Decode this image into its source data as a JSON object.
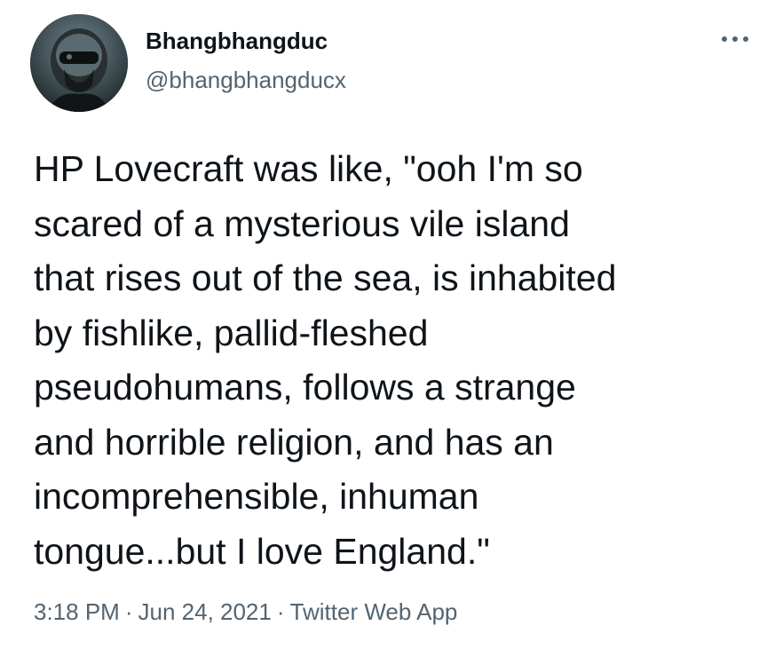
{
  "tweet": {
    "author": {
      "display_name": "Bhangbhangduc",
      "handle": "@bhangbhangducx",
      "avatar_icon": "avatar-helmeted-pilot"
    },
    "more_icon": "more-options-icon",
    "text": "HP Lovecraft was like, \"ooh I'm so scared of a mysterious vile island that rises out of the sea, is inhabited by fishlike, pallid-fleshed pseudohumans, follows a strange and horrible religion, and has an incomprehensible, inhuman tongue...but I love England.\"",
    "lines": [
      "HP Lovecraft was like, \"ooh I'm so",
      "scared of a mysterious vile island",
      "that rises out of the sea, is inhabited",
      "by fishlike, pallid-fleshed",
      "pseudohumans, follows a strange",
      "and horrible religion, and has an",
      "incomprehensible, inhuman",
      "tongue...but I love England.\""
    ],
    "meta": {
      "time": "3:18 PM",
      "separator": "·",
      "date": "Jun 24, 2021",
      "source": "Twitter Web App"
    },
    "colors": {
      "text": "#0f1419",
      "secondary": "#536471"
    }
  }
}
